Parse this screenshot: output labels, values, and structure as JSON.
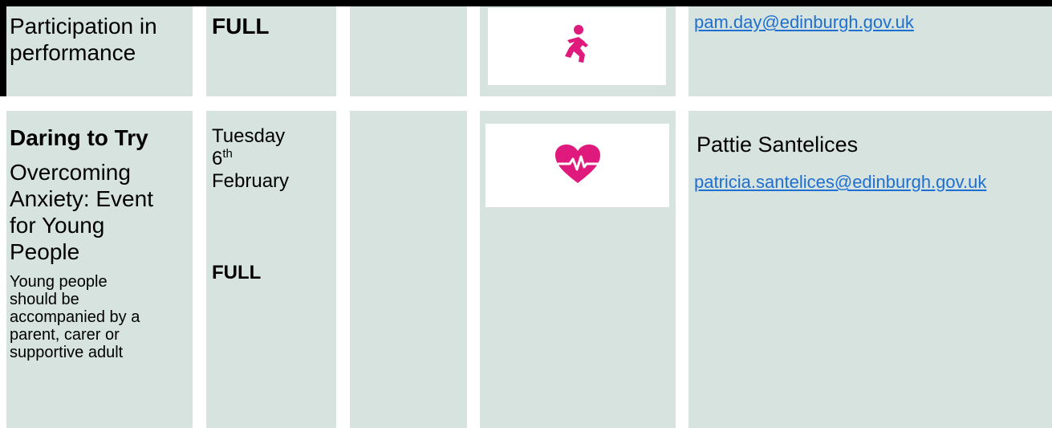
{
  "row1": {
    "title_lines": [
      "Participation in",
      "performance"
    ],
    "status": "FULL",
    "icon": "running-person-icon",
    "contact_email": "pam.day@edinburgh.gov.uk"
  },
  "row2": {
    "title_bold": "Daring to Try",
    "subtitle_lines": [
      "Overcoming",
      "Anxiety: Event",
      "for Young",
      "People"
    ],
    "note_lines": [
      "Young people",
      "should be",
      "accompanied by a",
      "parent, carer or",
      "supportive adult"
    ],
    "date_day": "Tuesday",
    "date_number": "6",
    "date_ordinal": "th",
    "date_month": "February",
    "status": "FULL",
    "icon": "heartbeat-icon",
    "contact_name": "Pattie Santelices",
    "contact_email": "patricia.santelices@edinburgh.gov.uk"
  },
  "colors": {
    "cell_bg": "#d6e3df",
    "icon_pink": "#e0197d",
    "link": "#1f6fd0"
  }
}
